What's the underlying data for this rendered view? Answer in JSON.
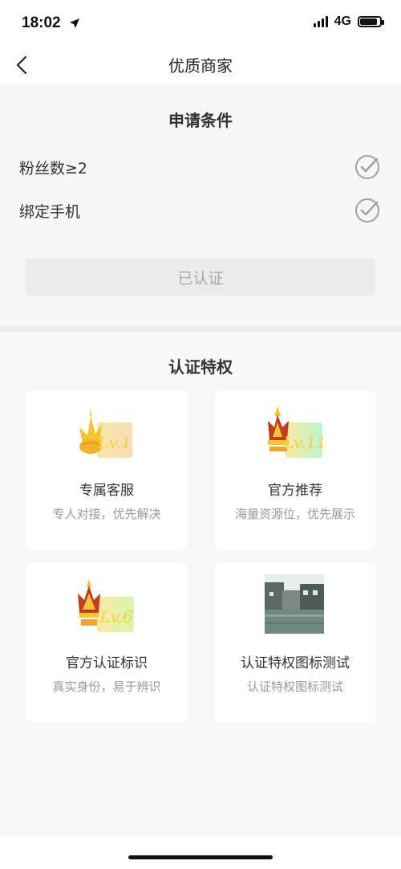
{
  "status_bar": {
    "time": "18:02",
    "network": "4G"
  },
  "nav": {
    "title": "优质商家",
    "back_icon": "chevron-left-icon"
  },
  "conditions": {
    "title": "申请条件",
    "items": [
      {
        "label": "粉丝数≥2",
        "checked": true
      },
      {
        "label": "绑定手机",
        "checked": true
      }
    ],
    "button_label": "已认证"
  },
  "privileges": {
    "title": "认证特权",
    "cards": [
      {
        "icon": "crown-lv1-icon",
        "title": "专属客服",
        "desc": "专人对接，优先解决"
      },
      {
        "icon": "crown-lv11-icon",
        "title": "官方推荐",
        "desc": "海量资源位，优先展示"
      },
      {
        "icon": "crown-lv6-icon",
        "title": "官方认证标识",
        "desc": "真实身份，易于辨识"
      },
      {
        "icon": "photo-thumbnail",
        "title": "认证特权图标测试",
        "desc": "认证特权图标测试"
      }
    ]
  },
  "colors": {
    "background": "#f6f6f6",
    "card": "#ffffff",
    "button_disabled_bg": "#ebebeb",
    "button_disabled_text": "#a9a9a9",
    "muted_text": "#999999"
  }
}
